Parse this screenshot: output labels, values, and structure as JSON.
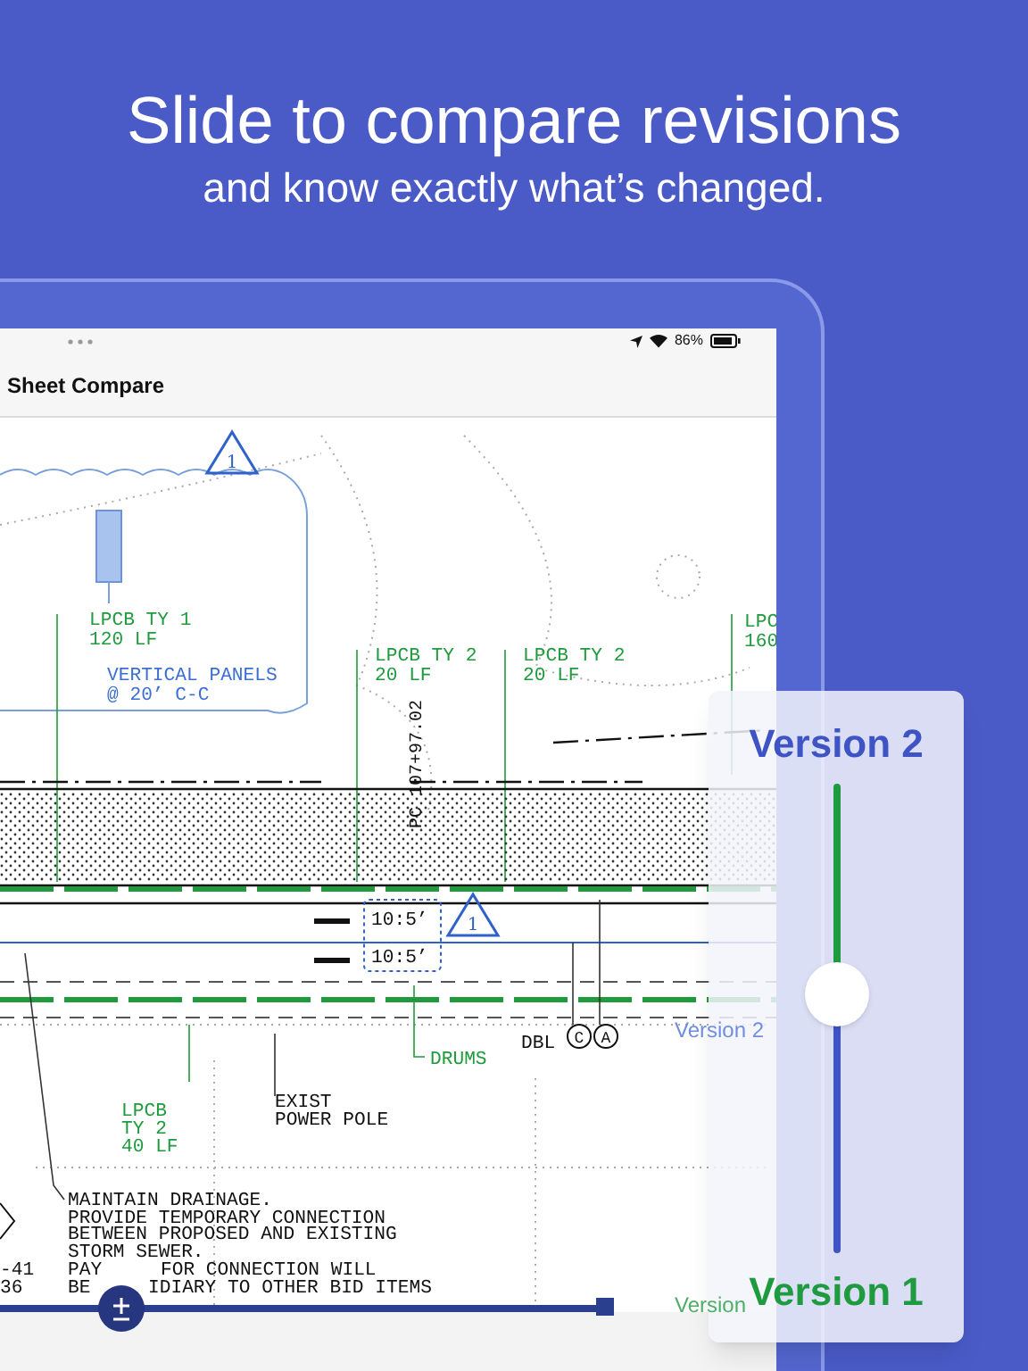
{
  "headline": {
    "title": "Slide to compare revisions",
    "subtitle": "and know exactly what’s changed."
  },
  "status_bar": {
    "battery": "86%"
  },
  "nav_bar": {
    "title": "Sheet Compare"
  },
  "drawing": {
    "labels": [
      {
        "text": "1",
        "kind": "revision"
      },
      {
        "text": "LPCB TY 1",
        "kind": "green"
      },
      {
        "text": "120 LF",
        "kind": "green"
      },
      {
        "text": "VERTICAL PANELS",
        "kind": "blue"
      },
      {
        "text": "@ 20’ C-C",
        "kind": "blue"
      },
      {
        "text": "LPCB TY 2",
        "kind": "green"
      },
      {
        "text": "20 LF",
        "kind": "green"
      },
      {
        "text": "LPCB TY 2",
        "kind": "green"
      },
      {
        "text": "20 LF",
        "kind": "green"
      },
      {
        "text": "LPC",
        "kind": "green"
      },
      {
        "text": "160",
        "kind": "green"
      },
      {
        "text": "PC 107+97.02",
        "kind": "vertical"
      },
      {
        "text": "10:5’",
        "kind": "black"
      },
      {
        "text": "10:5’",
        "kind": "black"
      },
      {
        "text": "1",
        "kind": "revision"
      },
      {
        "text": "DBL",
        "kind": "black"
      },
      {
        "text": "C",
        "kind": "circled"
      },
      {
        "text": "A",
        "kind": "circled"
      },
      {
        "text": "DRUMS",
        "kind": "green"
      },
      {
        "text": "LPCB",
        "kind": "green"
      },
      {
        "text": "TY 2",
        "kind": "green"
      },
      {
        "text": "40 LF",
        "kind": "green"
      },
      {
        "text": "EXIST",
        "kind": "black"
      },
      {
        "text": "POWER POLE",
        "kind": "black"
      },
      {
        "text": "MAINTAIN DRAINAGE.",
        "kind": "black"
      },
      {
        "text": "PROVIDE TEMPORARY CONNECTION",
        "kind": "black"
      },
      {
        "text": "BETWEEN PROPOSED AND EXISTING",
        "kind": "black"
      },
      {
        "text": "STORM SEWER.",
        "kind": "black"
      },
      {
        "text": "PAY",
        "kind": "black"
      },
      {
        "text": "FOR CONNECTION WILL",
        "kind": "black"
      },
      {
        "text": "BE",
        "kind": "black"
      },
      {
        "text": "IDIARY TO OTHER BID ITEMS",
        "kind": "black"
      },
      {
        "text": "-41",
        "kind": "black"
      },
      {
        "text": "36",
        "kind": "black"
      }
    ]
  },
  "ghost_labels": [
    {
      "text": "Version 2",
      "kind": "top"
    },
    {
      "text": "Version",
      "kind": "bottom"
    }
  ],
  "compare_slider": {
    "top_label": "Version 2",
    "bottom_label": "Version 1",
    "level": 0.55
  }
}
